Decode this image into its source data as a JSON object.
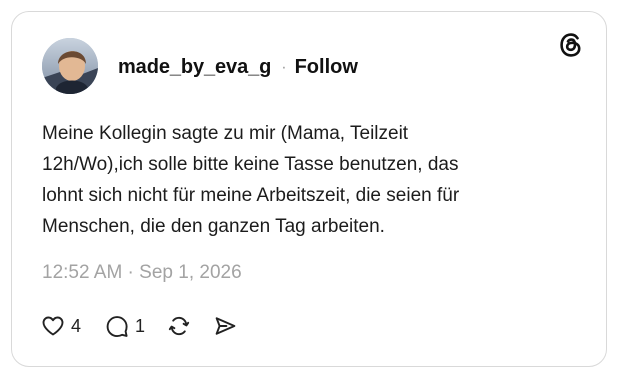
{
  "post": {
    "username": "made_by_eva_g",
    "separator": "·",
    "follow_label": "Follow",
    "text": "Meine Kollegin sagte zu mir (Mama, Teilzeit\n12h/Wo),ich solle bitte keine Tasse benutzen, das\nlohnt sich nicht für meine Arbeitszeit, die seien für\nMenschen, die den ganzen Tag arbeiten.",
    "timestamp": "12:52 AM · Sep 1, 2026",
    "likes": "4",
    "replies": "1"
  },
  "icons": {
    "brand": "threads-logo-icon",
    "like": "heart-icon",
    "reply": "speech-bubble-icon",
    "repost": "repost-icon",
    "share": "send-icon"
  },
  "colors": {
    "text": "#1c1c1c",
    "muted": "#a3a3a3",
    "border": "#d9d9d9"
  }
}
